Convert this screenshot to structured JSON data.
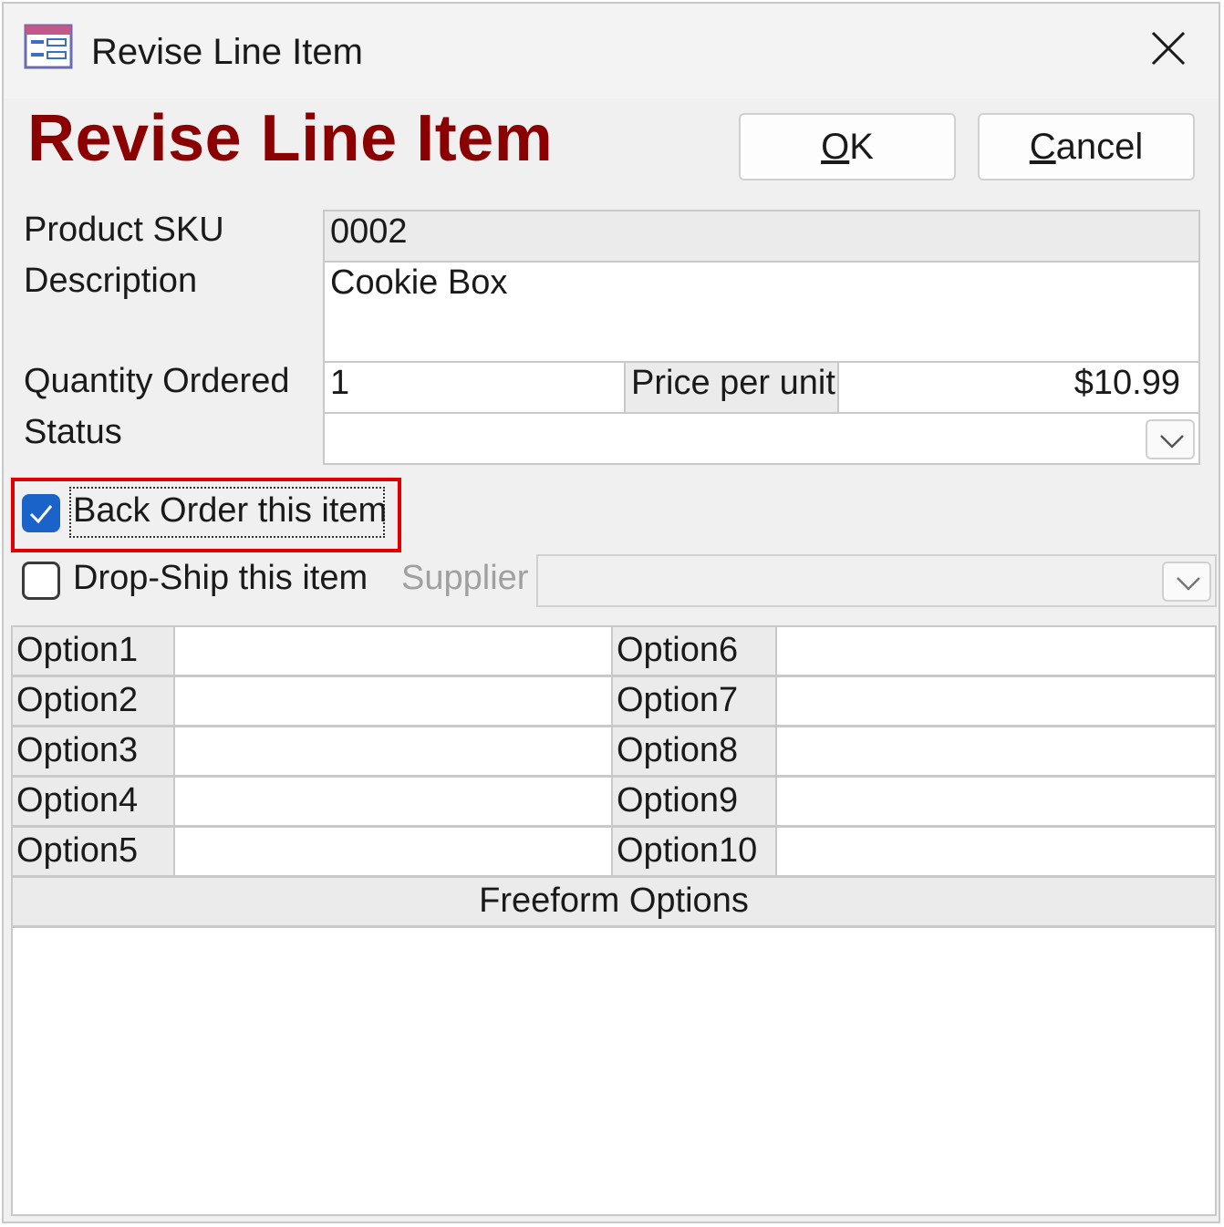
{
  "window": {
    "title": "Revise Line Item",
    "icon": "form-icon"
  },
  "header": {
    "heading": "Revise Line Item",
    "heading_color": "#8b0000",
    "ok_mnemonic": "O",
    "ok_rest": "K",
    "cancel_mnemonic": "C",
    "cancel_rest": "ancel"
  },
  "fields": {
    "sku_label": "Product SKU",
    "sku_value": "0002",
    "description_label": "Description",
    "description_value": "Cookie Box",
    "quantity_label": "Quantity Ordered",
    "quantity_value": "1",
    "price_label": "Price per unit",
    "price_value": "$10.99",
    "status_label": "Status",
    "status_value": ""
  },
  "checkboxes": {
    "back_order_label": "Back Order this item",
    "back_order_checked": true,
    "drop_ship_label": "Drop-Ship this item",
    "drop_ship_checked": false,
    "supplier_label": "Supplier",
    "supplier_value": ""
  },
  "options": {
    "left": [
      "Option1",
      "Option2",
      "Option3",
      "Option4",
      "Option5"
    ],
    "right": [
      "Option6",
      "Option7",
      "Option8",
      "Option9",
      "Option10"
    ],
    "freeform_label": "Freeform Options"
  },
  "colors": {
    "highlight": "#e00000",
    "checkbox_checked": "#1a63c9"
  }
}
